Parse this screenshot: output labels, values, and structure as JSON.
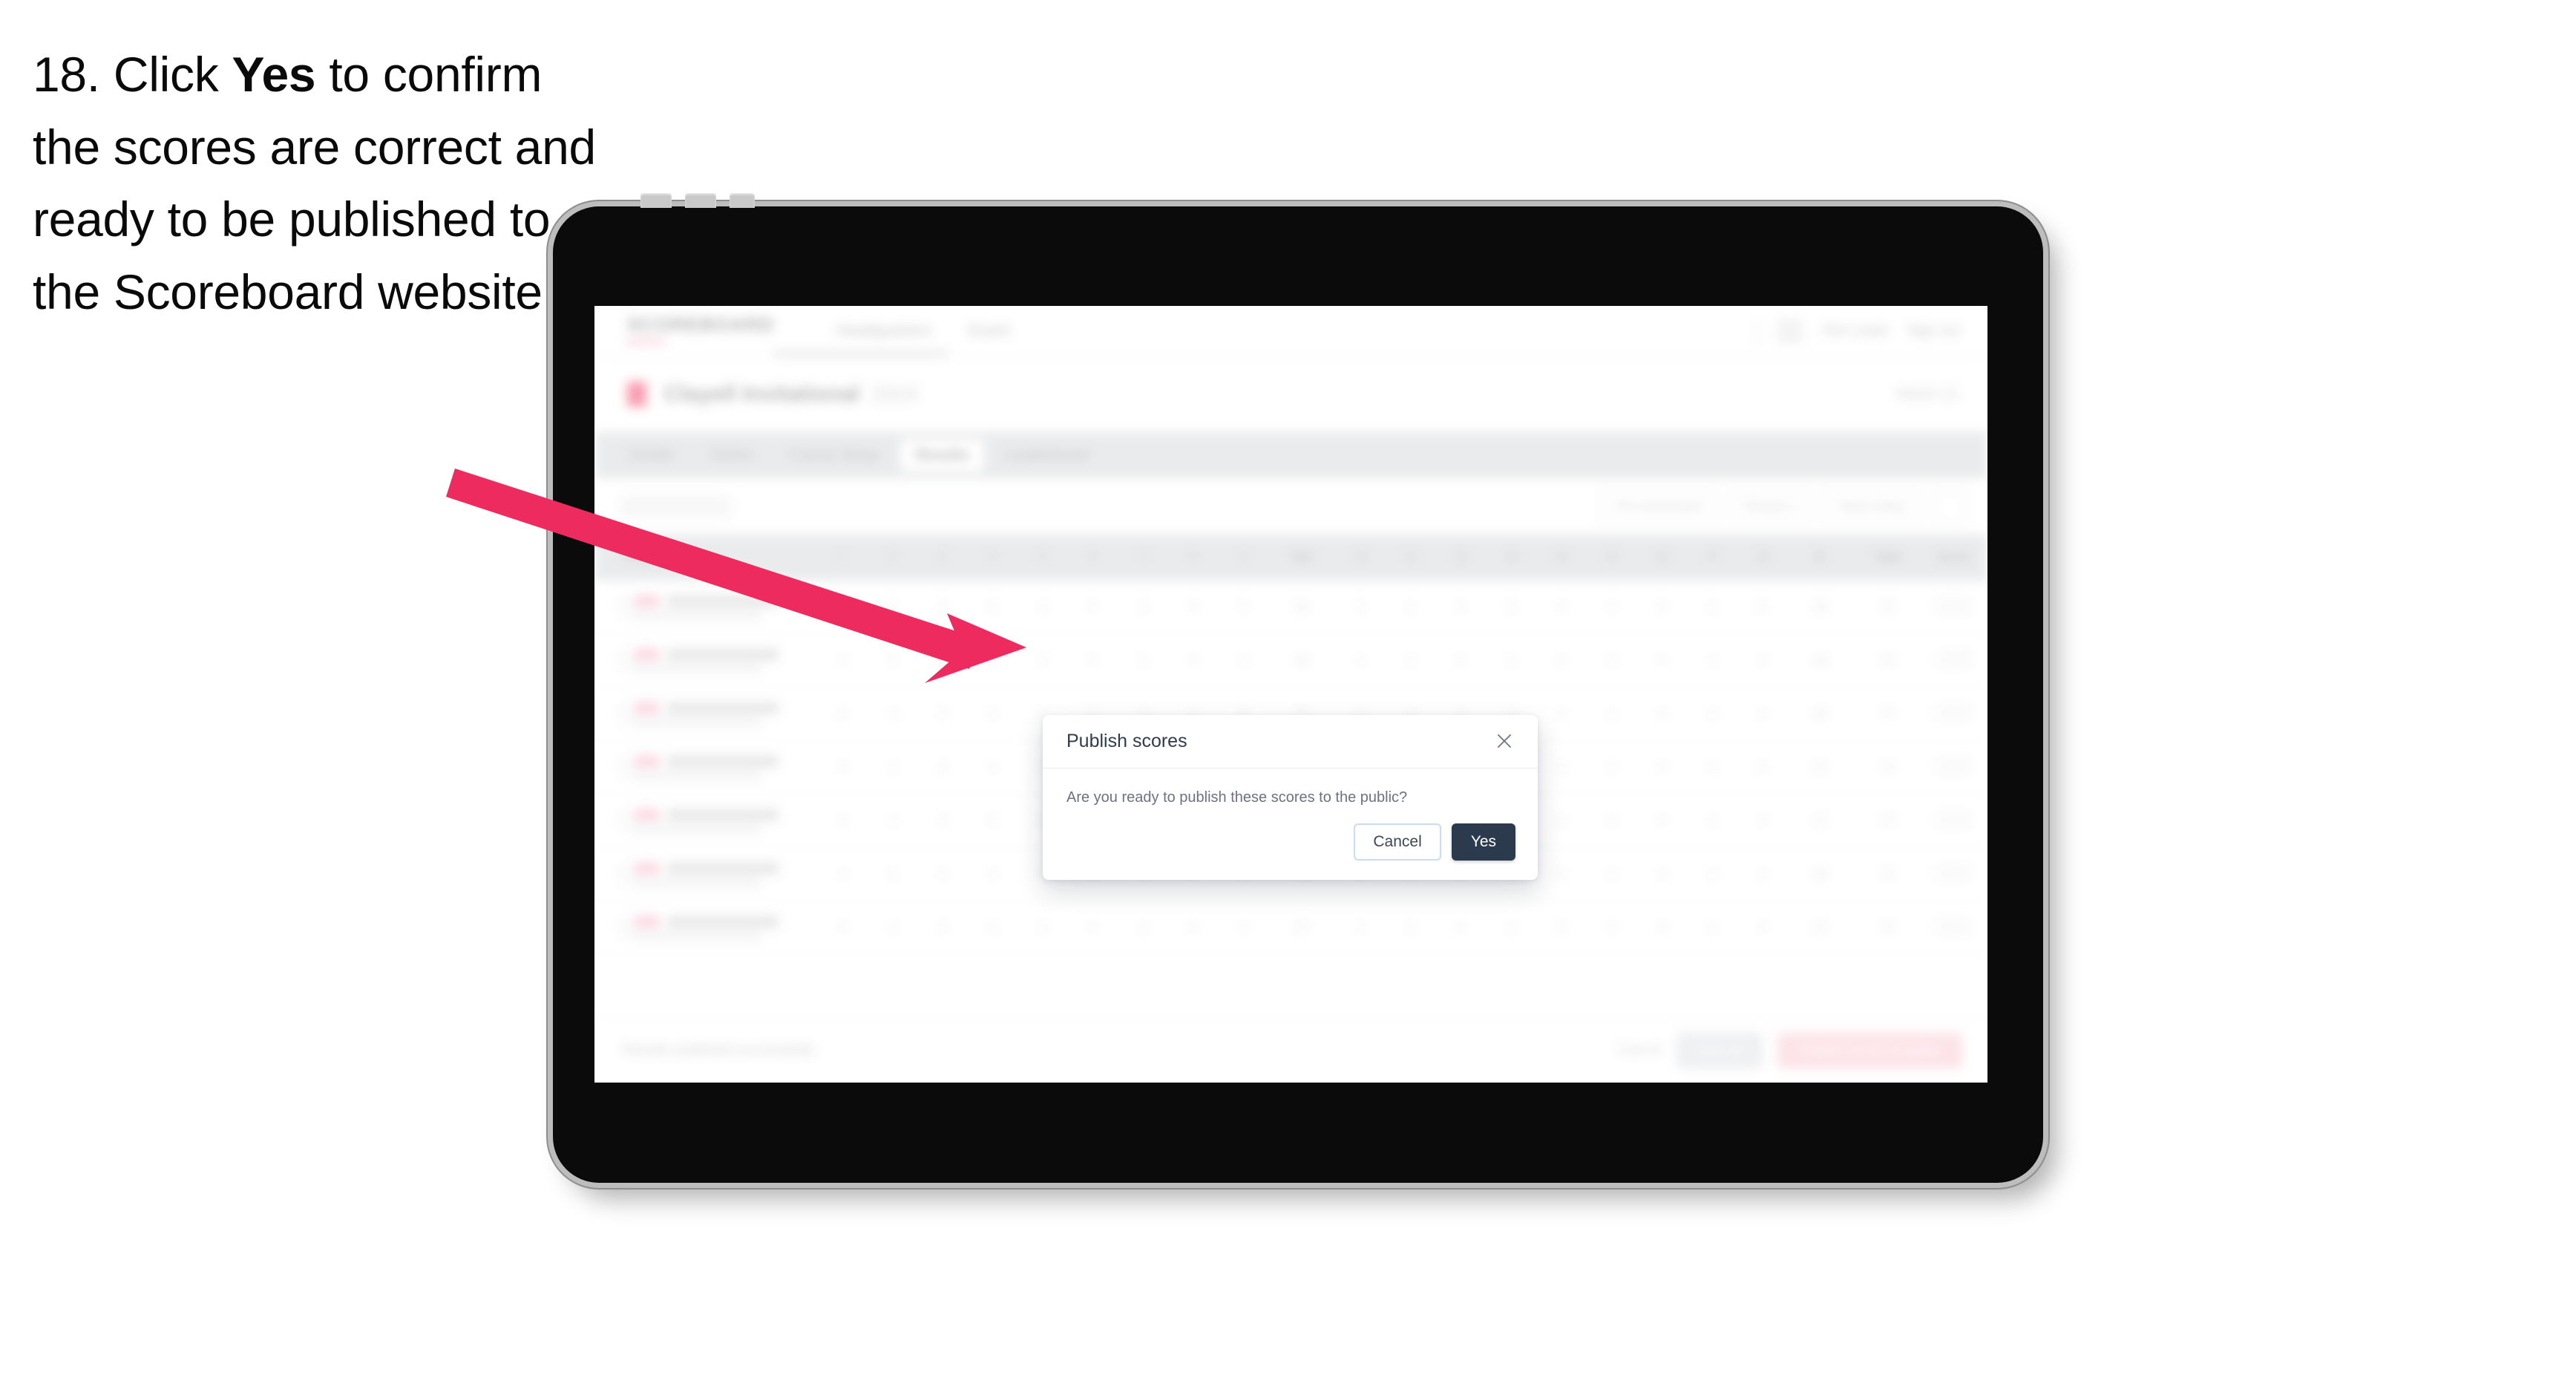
{
  "caption": {
    "number": "18.",
    "before": "Click ",
    "emphasis": "Yes",
    "after": " to confirm the scores are correct and ready to be published to the Scoreboard website."
  },
  "device": {
    "type": "tablet",
    "orientation": "landscape",
    "bezel_color": "#0b0b0b",
    "frame_color": "#bdbdbd"
  },
  "annotation": {
    "arrow_color": "#ED2B5E",
    "points_to": "yes-button"
  },
  "app": {
    "header": {
      "brand_main": "SCOREBOARD",
      "brand_sub": "EVENTS",
      "nav": [
        "Headquarters",
        "Event"
      ],
      "user_name": "Tom Lewis",
      "sign_out": "Sign out"
    },
    "event": {
      "name": "Clayell Invitational",
      "date": "2024",
      "right_label": "Week 12"
    },
    "tabs": [
      {
        "label": "Details",
        "active": false
      },
      {
        "label": "Teams",
        "active": false
      },
      {
        "label": "Course Setup",
        "active": false
      },
      {
        "label": "Results",
        "active": true
      },
      {
        "label": "Leaderboard",
        "active": false
      }
    ],
    "filters": {
      "search_placeholder": "Search",
      "pills": [
        "Pro Scorecard",
        "Round 1"
      ],
      "sort_label": "Team Entry"
    },
    "table": {
      "columns": [
        "Player",
        "1",
        "2",
        "3",
        "4",
        "5",
        "6",
        "7",
        "8",
        "9",
        "Out",
        "10",
        "11",
        "12",
        "13",
        "14",
        "15",
        "16",
        "17",
        "18",
        "In",
        "Total",
        "Score"
      ],
      "rows": [
        {
          "rank": "1",
          "name": "Marcus Tennant",
          "club": "Eastmoor Country"
        },
        {
          "rank": "2",
          "name": "Ryan Parnell",
          "club": "Crescent Heritage"
        },
        {
          "rank": "3",
          "name": "Cameron Redmond",
          "club": ""
        },
        {
          "rank": "4",
          "name": "Colin Whitworth",
          "club": "Northcliffe Links Club"
        },
        {
          "rank": "5",
          "name": "Oliver Abbot",
          "club": "Brambleton Valley Club"
        },
        {
          "rank": "6",
          "name": "Ross Britt",
          "club": "Hawkridge Country Club"
        },
        {
          "rank": "7",
          "name": "Nick Staley",
          "club": "Redfield Commons Club"
        }
      ]
    },
    "footer": {
      "note": "Results published successfully",
      "link": "Cancel",
      "secondary_button": "Save all",
      "primary_button": "Publish scores to public"
    }
  },
  "modal": {
    "title": "Publish scores",
    "message": "Are you ready to publish these scores to the public?",
    "cancel_label": "Cancel",
    "confirm_label": "Yes",
    "close_icon": "close-icon",
    "confirm_color": "#2C3A4D"
  }
}
